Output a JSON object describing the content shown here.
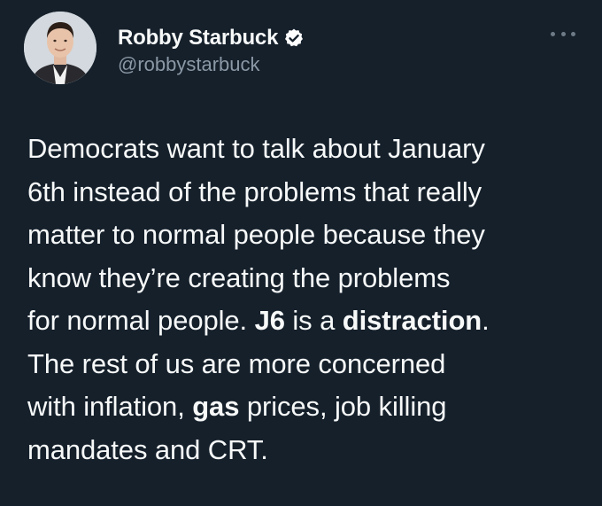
{
  "author": {
    "display_name": "Robby Starbuck",
    "handle": "@robbystarbuck",
    "verified": true,
    "avatar_icon": "profile-photo"
  },
  "menu": {
    "icon": "more-options-icon"
  },
  "tweet": {
    "lines": [
      [
        {
          "text": "Democrats want to talk about January",
          "bold": false
        }
      ],
      [
        {
          "text": "6th instead of the problems that really",
          "bold": false
        }
      ],
      [
        {
          "text": "matter to normal people because they",
          "bold": false
        }
      ],
      [
        {
          "text": "know they’re creating the problems",
          "bold": false
        }
      ],
      [
        {
          "text": "for normal people. ",
          "bold": false
        },
        {
          "text": "J6",
          "bold": true
        },
        {
          "text": " is a ",
          "bold": false
        },
        {
          "text": "distraction",
          "bold": true
        },
        {
          "text": ".",
          "bold": false
        }
      ],
      [
        {
          "text": "The rest of us are more concerned",
          "bold": false
        }
      ],
      [
        {
          "text": "with inflation, ",
          "bold": false
        },
        {
          "text": "gas",
          "bold": true
        },
        {
          "text": " prices, job killing",
          "bold": false
        }
      ],
      [
        {
          "text": "mandates and CRT.",
          "bold": false
        }
      ]
    ]
  },
  "colors": {
    "background": "#15202b",
    "text_primary": "#f7f9f9",
    "text_secondary": "#8b98a5",
    "verified_badge": "#ffffff"
  }
}
